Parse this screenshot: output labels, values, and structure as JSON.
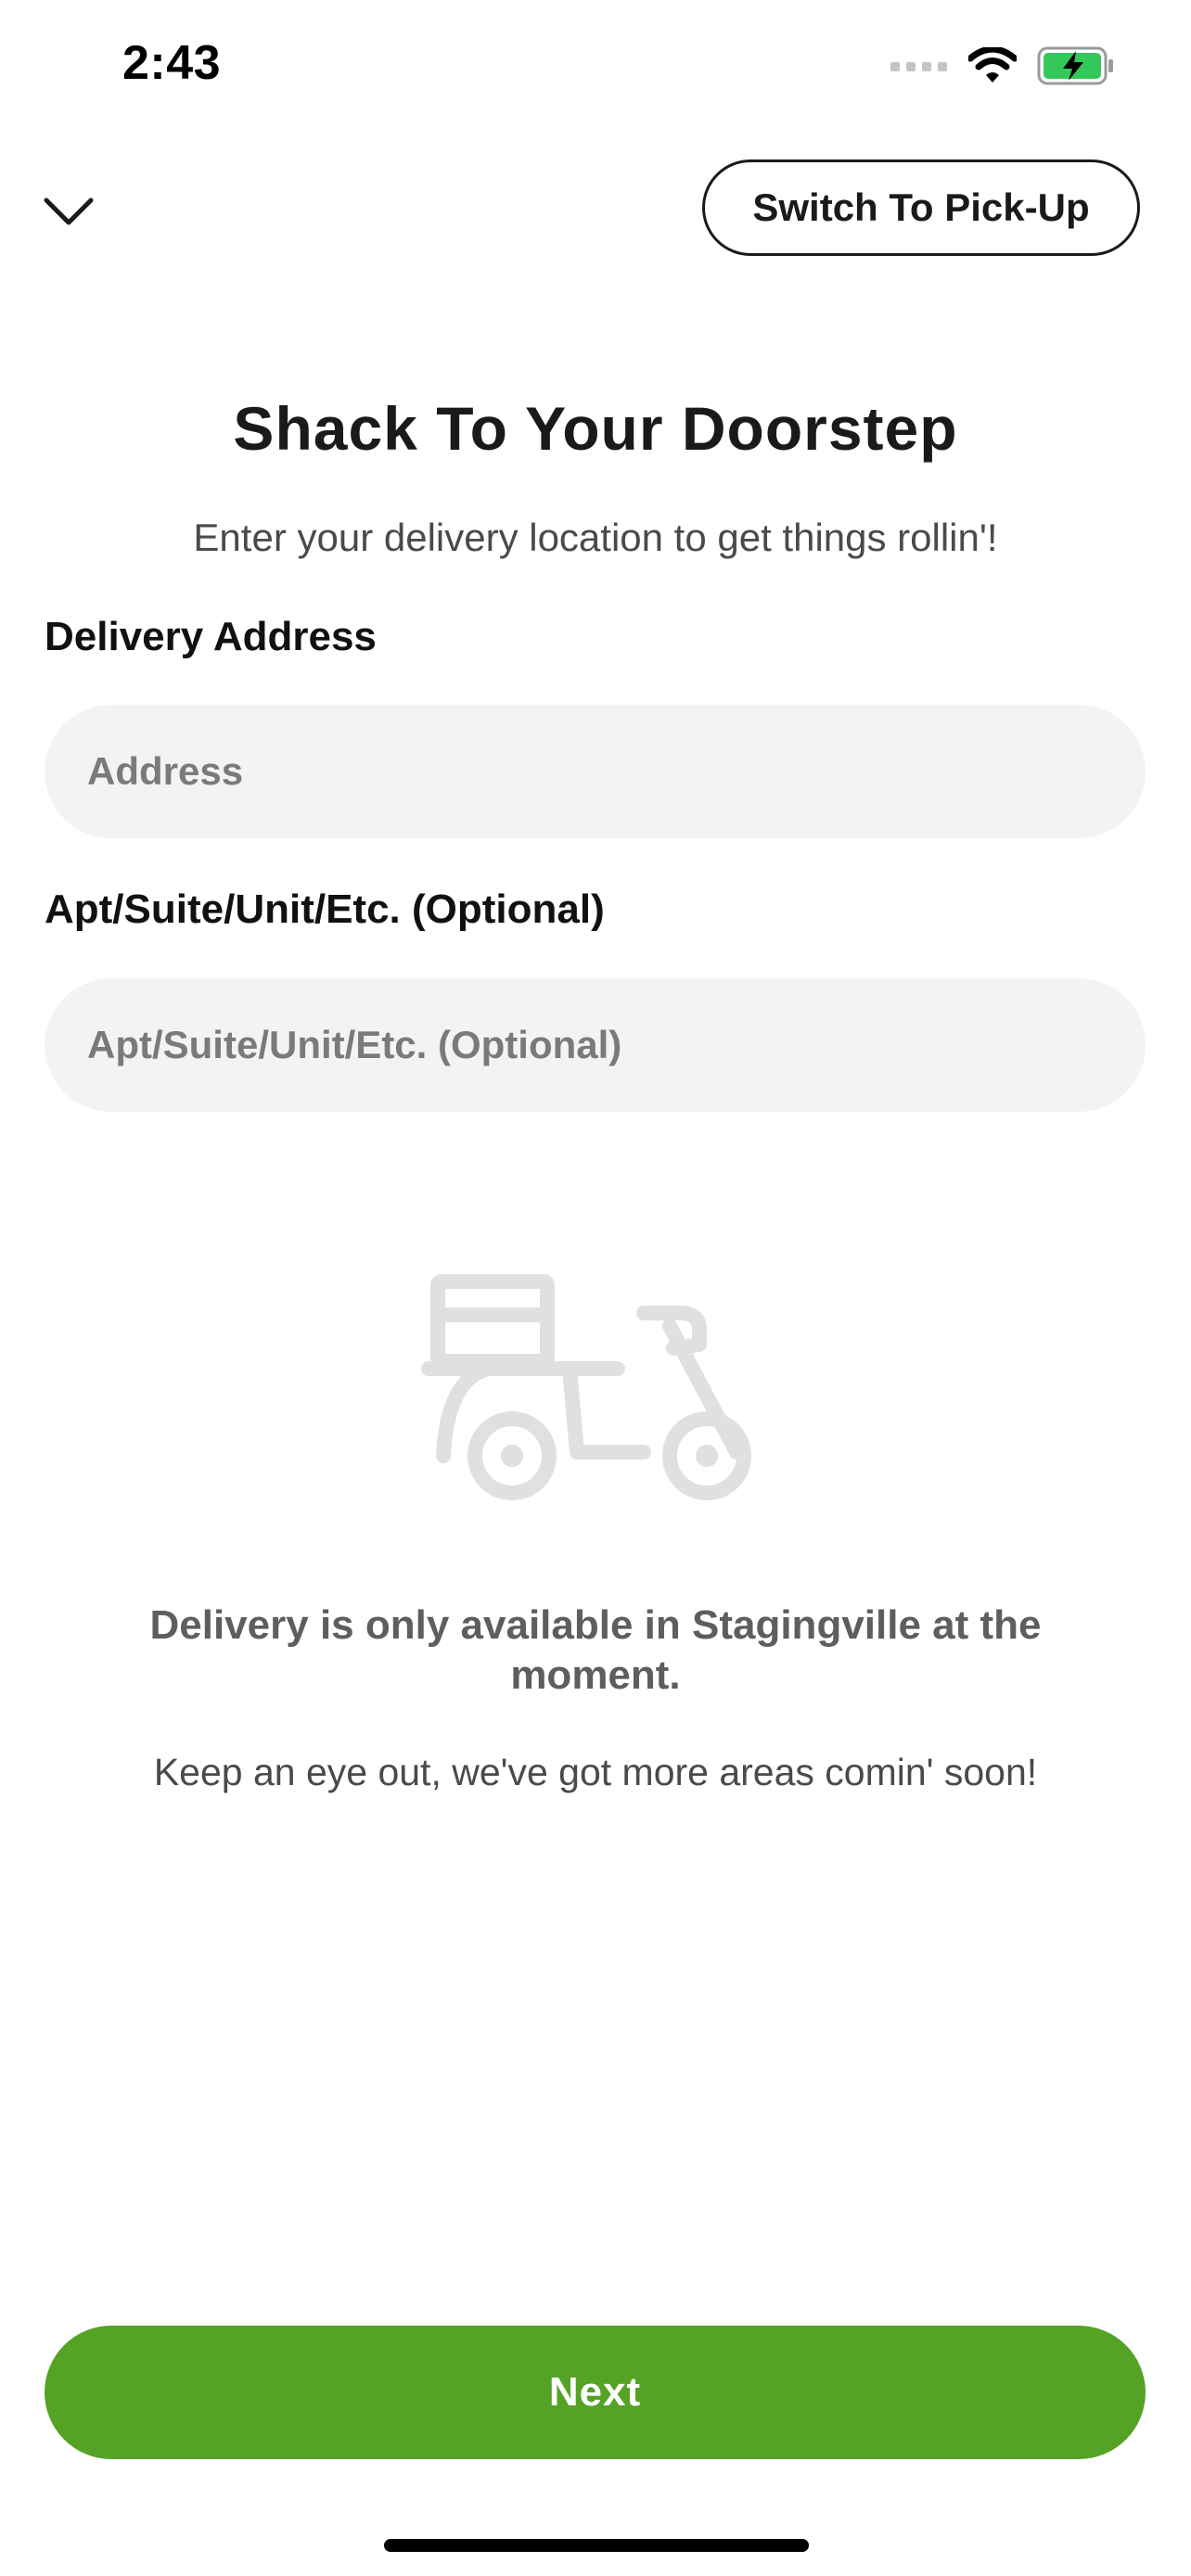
{
  "status_bar": {
    "time": "2:43",
    "icons": [
      "signal-icon",
      "wifi-icon",
      "battery-charging-icon"
    ]
  },
  "header": {
    "close_icon": "chevron-down-icon",
    "switch_label": "Switch To Pick-Up"
  },
  "main": {
    "title": "Shack To Your Doorstep",
    "subtitle": "Enter your delivery location to get things rollin'!",
    "address_label": "Delivery Address",
    "address_placeholder": "Address",
    "address_value": "",
    "apt_label": "Apt/Suite/Unit/Etc. (Optional)",
    "apt_placeholder": "Apt/Suite/Unit/Etc. (Optional)",
    "apt_value": "",
    "illustration_icon": "delivery-scooter-icon",
    "notice_title": "Delivery is only available in Stagingville at the moment.",
    "notice_body": "Keep an eye out, we've got more areas comin' soon!"
  },
  "footer": {
    "next_label": "Next"
  },
  "colors": {
    "accent": "#54a325",
    "input_background": "#f3f3f3",
    "battery_green": "#34c759",
    "illustration_gray": "#e0e0e0"
  }
}
